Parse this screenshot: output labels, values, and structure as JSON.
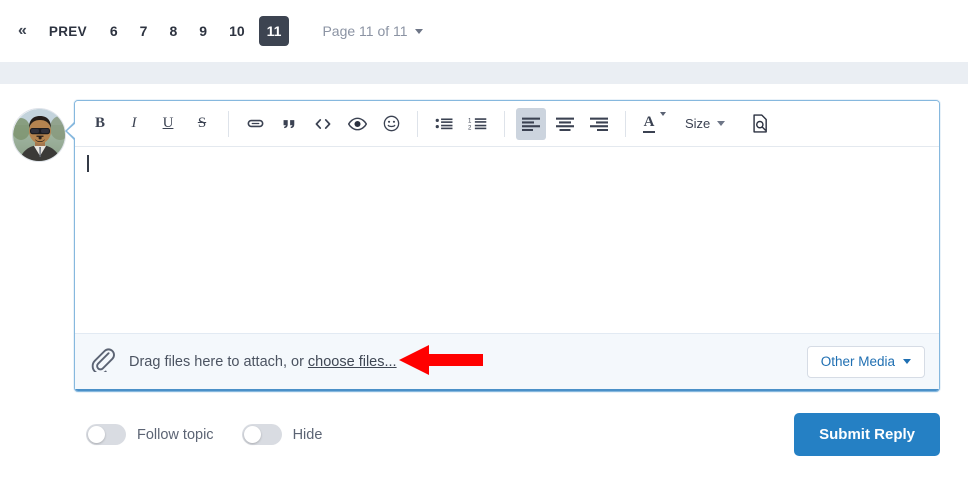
{
  "pagination": {
    "first_icon": "double-chevron-left-icon",
    "first_glyph": "«",
    "prev_label": "PREV",
    "pages": [
      "6",
      "7",
      "8",
      "9",
      "10",
      "11"
    ],
    "active_page": "11",
    "page_select_label": "Page 11 of 11",
    "active_bg": "#3d4451",
    "active_fg": "#ffffff"
  },
  "editor": {
    "avatar_name": "user-avatar",
    "border_color": "#86b8de",
    "caret_visible": true,
    "body_text": "",
    "toolbar": {
      "bold": "B",
      "italic": "I",
      "underline": "U",
      "strikethrough": "S",
      "link_icon": "link-icon",
      "quote_icon": "quote-icon",
      "code_icon": "code-icon",
      "spoiler_icon": "eye-icon",
      "emoji_icon": "smiley-icon",
      "bullet_list_icon": "bullet-list-icon",
      "numbered_list_icon": "numbered-list-icon",
      "align_left_icon": "align-left-icon",
      "align_center_icon": "align-center-icon",
      "align_right_icon": "align-right-icon",
      "text_color_glyph": "A",
      "size_label": "Size",
      "preview_icon": "document-search-icon",
      "active_button": "align-left-icon",
      "active_bg": "#ccd4de"
    }
  },
  "attach": {
    "clip_icon": "paperclip-icon",
    "prompt_text": "Drag files here to attach, or ",
    "link_text": "choose files...",
    "other_media_label": "Other Media",
    "other_media_color": "#1f6fb2",
    "strip_bg": "#f4f8fc",
    "annotation": {
      "name": "red-arrow-annotation",
      "color": "#ff0000",
      "direction": "left"
    }
  },
  "footer": {
    "follow_topic_label": "Follow topic",
    "follow_topic_on": false,
    "hide_label": "Hide",
    "hide_on": false,
    "submit_label": "Submit Reply",
    "submit_bg": "#2580c4"
  }
}
